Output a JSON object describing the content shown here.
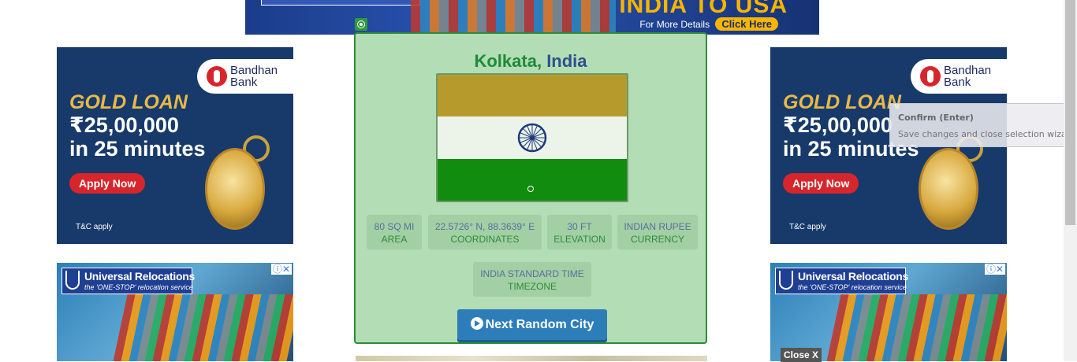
{
  "top_ad": {
    "headline": "INDIA TO USA",
    "details": "For More Details",
    "cta": "Click Here"
  },
  "gold_ad": {
    "bank_name_line1": "Bandhan",
    "bank_name_line2": "Bank",
    "title": "GOLD LOAN",
    "amount": "₹25,00,000",
    "minutes": "in 25 minutes",
    "apply": "Apply Now",
    "tnc": "T&C apply"
  },
  "reloc_ad": {
    "name": "Universal Relocations",
    "tagline": "the 'ONE-STOP' relocation service",
    "adchoice": "ⓘ✕"
  },
  "close_label": "Close X",
  "city": {
    "name": "Kolkata",
    "separator": ",",
    "country": "India",
    "stats": [
      {
        "value": "80 SQ MI",
        "label": "AREA"
      },
      {
        "value": "22.5726° N, 88.3639° E",
        "label": "COORDINATES"
      },
      {
        "value": "30 FT",
        "label": "ELEVATION"
      },
      {
        "value": "INDIAN RUPEE",
        "label": "CURRENCY"
      },
      {
        "value": "INDIA STANDARD TIME",
        "label": "TIMEZONE"
      }
    ],
    "next_button": "Next Random City"
  },
  "tooltip": {
    "title": "Confirm (Enter)",
    "body": "Save changes and close selection wizard."
  },
  "colors": {
    "card_bg": "#b3ddb4",
    "card_border": "#2e8b3a",
    "button": "#2d7db8",
    "flag_saffron": "#b79a2c",
    "flag_green": "#118c0f",
    "chakra": "#1f3a7a"
  },
  "icons": {
    "target": "target-icon",
    "next": "arrow-right-circle-icon",
    "chakra": "ashoka-chakra-icon"
  }
}
